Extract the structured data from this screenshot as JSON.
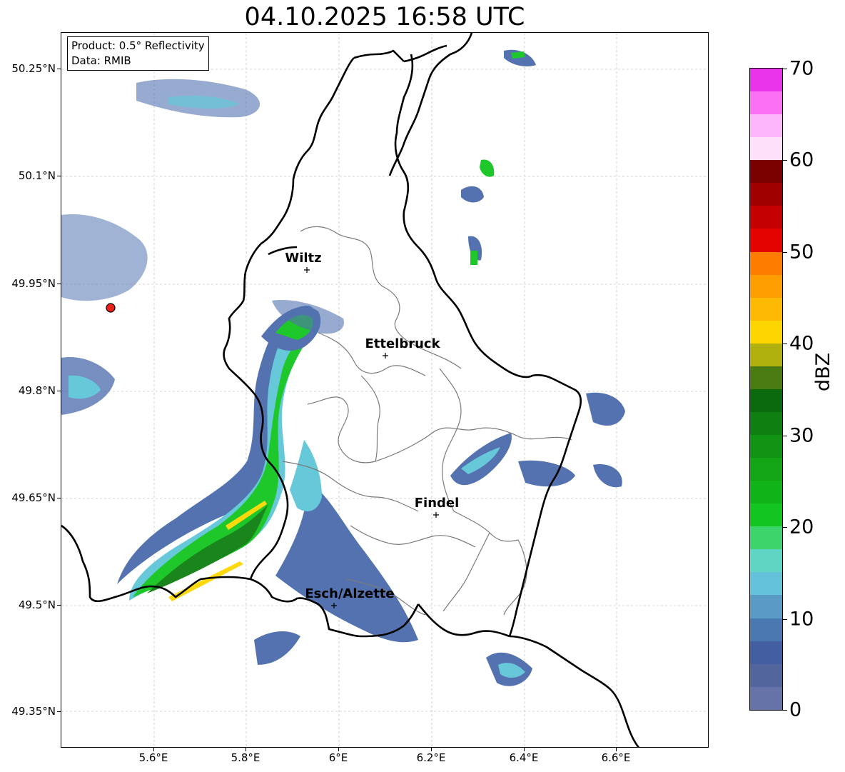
{
  "title": "04.10.2025 16:58 UTC",
  "info": {
    "product": "Product: 0.5° Reflectivity",
    "data_source": "Data: RMIB"
  },
  "lat_ticks": [
    "50.25°N",
    "50.1°N",
    "49.95°N",
    "49.8°N",
    "49.65°N",
    "49.5°N",
    "49.35°N"
  ],
  "lon_ticks": [
    "5.6°E",
    "5.8°E",
    "6°E",
    "6.2°E",
    "6.4°E",
    "6.6°E"
  ],
  "cities": [
    {
      "name": "Wiltz"
    },
    {
      "name": "Ettelbruck"
    },
    {
      "name": "Findel"
    },
    {
      "name": "Esch/Alzette"
    }
  ],
  "radar_site": {
    "marker_color": "#e8221b"
  },
  "colorbar": {
    "label": "dBZ",
    "tick_labels": [
      "70",
      "60",
      "50",
      "40",
      "30",
      "20",
      "10",
      "0"
    ],
    "colors": [
      "#6573a8",
      "#52669d",
      "#435ea1",
      "#4a78b1",
      "#5a9bc6",
      "#63c2da",
      "#5fd6c4",
      "#3dd46c",
      "#12c51f",
      "#10b418",
      "#13a515",
      "#139314",
      "#0f7f11",
      "#0c6a0e",
      "#497b12",
      "#b0b10f",
      "#fdd600",
      "#fdb903",
      "#fe9d00",
      "#fe7c00",
      "#e50302",
      "#c50000",
      "#a10000",
      "#7b0000",
      "#fde1fb",
      "#fcb6f9",
      "#fc71f3",
      "#e934ec"
    ]
  }
}
